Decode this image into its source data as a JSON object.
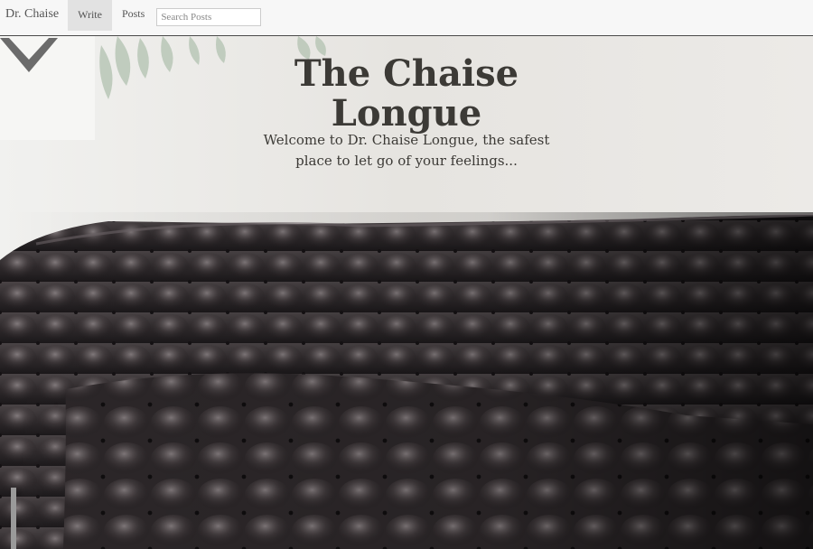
{
  "navbar": {
    "brand": "Dr. Chaise",
    "items": [
      {
        "label": "Write",
        "active": true
      },
      {
        "label": "Posts",
        "active": false
      }
    ],
    "search": {
      "placeholder": "Search Posts",
      "value": ""
    }
  },
  "hero": {
    "title": "The Chaise Longue",
    "subtitle": "Welcome to Dr. Chaise Longue, the safest place to let go of your feelings...",
    "scroll_icon": "chevron-down-icon",
    "background_image": "tufted-leather-sofa-photo",
    "colors": {
      "text": "#3c3a36",
      "chevron": "#6b6b6b",
      "wall": "#eceae6",
      "sofa": "#3a3436"
    }
  }
}
